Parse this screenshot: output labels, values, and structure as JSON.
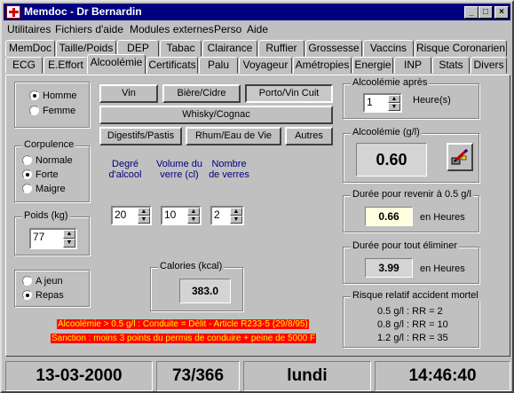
{
  "window": {
    "title": "Memdoc - Dr Bernardin",
    "minimize": "_",
    "maximize": "□",
    "close": "×"
  },
  "menu": [
    "Utilitaires",
    "Fichiers d'aide",
    "Modules externes",
    "Perso",
    "Aide"
  ],
  "tabs_row1": [
    "MemDoc",
    "Taille/Poids",
    "DEP",
    "Tabac",
    "Clairance",
    "Ruffier",
    "Grossesse",
    "Vaccins",
    "Risque Coronarien"
  ],
  "tabs_row2": [
    "ECG",
    "E.Effort",
    "Alcoolémie",
    "Certificats",
    "Palu",
    "Voyageur",
    "Amétropies",
    "Energie",
    "INP",
    "Stats",
    "Divers"
  ],
  "active_tab": "Alcoolémie",
  "sex": {
    "options": [
      "Homme",
      "Femme"
    ],
    "selected": "Homme"
  },
  "corpulence": {
    "title": "Corpulence",
    "options": [
      "Normale",
      "Forte",
      "Maigre"
    ],
    "selected": "Forte"
  },
  "poids": {
    "title": "Poids (kg)",
    "value": "77"
  },
  "repas": {
    "options": [
      "A jeun",
      "Repas"
    ],
    "selected": "Repas"
  },
  "drinks": {
    "vin": "Vin",
    "biere": "Bière/Cidre",
    "porto": "Porto/Vin Cuit",
    "whisky": "Whisky/Cognac",
    "digestifs": "Digestifs/Pastis",
    "rhum": "Rhum/Eau de Vie",
    "autres": "Autres",
    "selected": "Porto/Vin Cuit"
  },
  "params": {
    "degre_label": "Degré d'alcool",
    "volume_label": "Volume du verre (cl)",
    "nombre_label": "Nombre de verres",
    "degre": "20",
    "volume": "10",
    "nombre": "2"
  },
  "calories": {
    "title": "Calories (kcal)",
    "value": "383.0"
  },
  "warnings": [
    "Alcoolémie > 0.5 g/l : Conduite = Délit - Article R233-5 (29/8/95)",
    "Sanction : moins 3 points du permis de conduire + peine de 5000 F"
  ],
  "apres": {
    "title": "Alcoolémie après",
    "value": "1",
    "unit": "Heure(s)"
  },
  "alcoolemie": {
    "title": "Alcoolémie (g/l)",
    "value": "0.60"
  },
  "duree05": {
    "title": "Durée pour revenir à 0.5 g/l",
    "value": "0.66",
    "unit": "en Heures"
  },
  "dureeAll": {
    "title": "Durée pour tout éliminer",
    "value": "3.99",
    "unit": "en Heures"
  },
  "risque": {
    "title": "Risque relatif accident mortel",
    "rows": [
      "0.5 g/l : RR = 2",
      "0.8 g/l : RR = 10",
      "1.2 g/l : RR = 35"
    ]
  },
  "statusbar": {
    "date": "13-03-2000",
    "day_of_year": "73/366",
    "weekday": "lundi",
    "time": "14:46:40"
  },
  "colors": {
    "titlebar": "#000080",
    "warning_bg": "#ff0000",
    "warning_fg": "#ffff00",
    "label_blue": "#000080"
  },
  "icons": [
    "app-icon",
    "calculator-pencil-icon"
  ]
}
